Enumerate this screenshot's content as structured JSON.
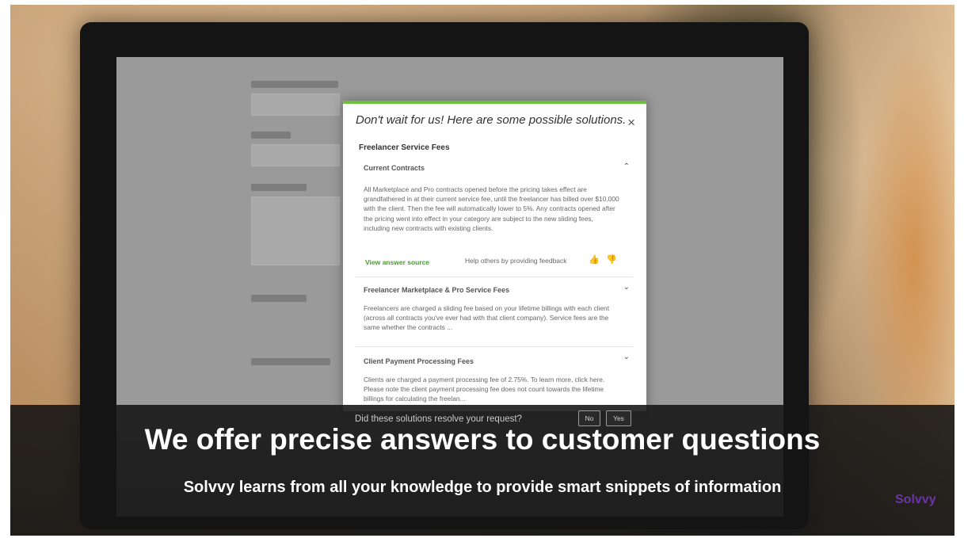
{
  "modal": {
    "heading": "Don't wait for us! Here are some possible solutions.",
    "close_label": "×",
    "section_title": "Freelancer Service Fees",
    "articles": [
      {
        "title": "Current Contracts",
        "expanded": true,
        "chevron": "⌃",
        "body": "All Marketplace and Pro contracts opened before the pricing takes effect are grandfathered in at their current service fee, until the freelancer has billed over $10,000 with the client. Then the fee will automatically lower to 5%. Any contracts opened after the pricing went into effect in your category are subject to the new sliding fees, including new contracts with existing clients."
      },
      {
        "title": "Freelancer Marketplace & Pro Service Fees",
        "expanded": false,
        "chevron": "⌄",
        "body": "Freelancers are charged a sliding fee based on your lifetime billings with each client (across all contracts you've ever had with that client company). Service fees are the same whether the contracts ..."
      },
      {
        "title": "Client Payment Processing Fees",
        "expanded": false,
        "chevron": "⌄",
        "body": "Clients are charged a payment processing fee of 2.75%. To learn more, click here. Please note the client payment processing fee does not count towards the lifetime billings for calculating the freelan..."
      }
    ],
    "source_link": "View answer source",
    "feedback_text": "Help others by providing feedback",
    "thumb_up": "👍",
    "thumb_down": "👎"
  },
  "resolve": {
    "question": "Did these solutions resolve your request?",
    "no_label": "No",
    "yes_label": "Yes"
  },
  "caption": {
    "headline": "We offer precise answers to customer questions",
    "subline": "Solvvy learns from all your knowledge to provide smart snippets of information"
  },
  "brand": {
    "name": "Solvvy",
    "color": "#6b35a9"
  },
  "colors": {
    "accent": "#6fbf3f",
    "link": "#4a9b2f"
  }
}
